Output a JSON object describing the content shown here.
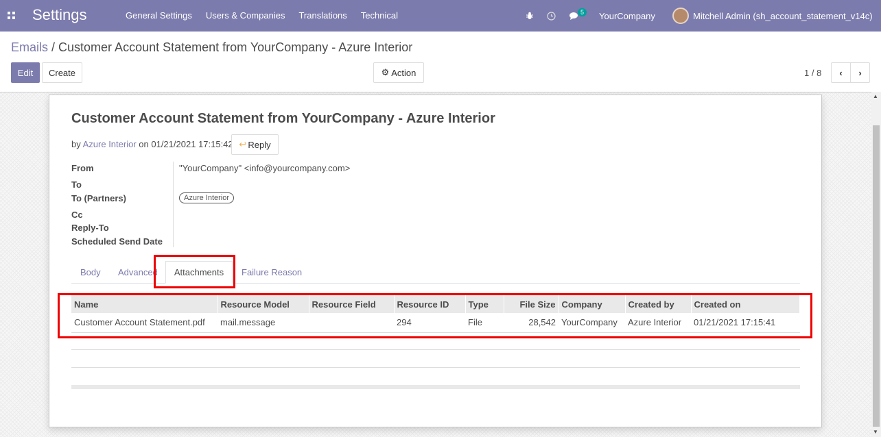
{
  "navbar": {
    "app_title": "Settings",
    "menu": [
      "General Settings",
      "Users & Companies",
      "Translations",
      "Technical"
    ],
    "chat_badge": "5",
    "company": "YourCompany",
    "user": "Mitchell Admin (sh_account_statement_v14c)",
    "icons": [
      "apps-icon",
      "bug-icon",
      "clock-icon",
      "chat-icon",
      "avatar"
    ]
  },
  "breadcrumb": {
    "parent": "Emails",
    "separator": " / ",
    "current": "Customer Account Statement from YourCompany - Azure Interior"
  },
  "toolbar": {
    "edit": "Edit",
    "create": "Create",
    "action": "Action",
    "pager": "1 / 8"
  },
  "message": {
    "title": "Customer Account Statement from YourCompany - Azure Interior",
    "by": "by ",
    "author": "Azure Interior",
    "on": " on 01/21/2021 17:15:42",
    "reply": "Reply"
  },
  "fields": {
    "from_label": "From",
    "from_value": "\"YourCompany\" <info@yourcompany.com>",
    "to_label": "To",
    "to_partners_label": "To (Partners)",
    "to_partners_tag": "Azure Interior",
    "cc_label": "Cc",
    "reply_to_label": "Reply-To",
    "scheduled_label": "Scheduled Send Date"
  },
  "tabs": [
    "Body",
    "Advanced",
    "Attachments",
    "Failure Reason"
  ],
  "table": {
    "headers": [
      "Name",
      "Resource Model",
      "Resource Field",
      "Resource ID",
      "Type",
      "File Size",
      "Company",
      "Created by",
      "Created on"
    ],
    "rows": [
      [
        "Customer Account Statement.pdf",
        "mail.message",
        "",
        "294",
        "File",
        "28,542",
        "YourCompany",
        "Azure Interior",
        "01/21/2021 17:15:41"
      ]
    ]
  },
  "colors": {
    "navbar": "#7c7bad",
    "accent": "#7c7bad",
    "highlight": "#ee0000",
    "badge": "#00a09d"
  }
}
